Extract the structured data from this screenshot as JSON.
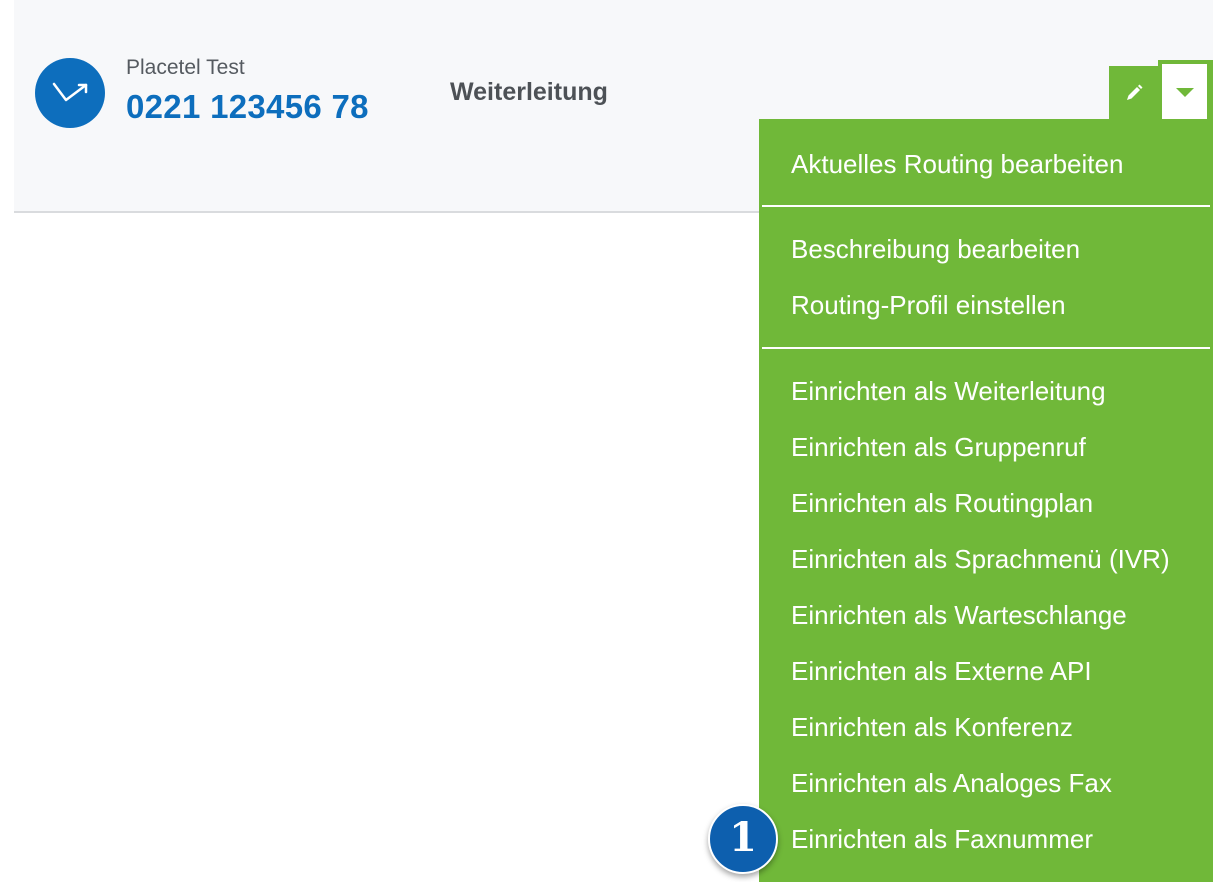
{
  "number": {
    "caption": "Placetel Test",
    "phone": "0221 123456 78",
    "routing_type": "Weiterleitung",
    "icon": "forward-arrow-icon"
  },
  "actions": {
    "edit_icon": "pencil-icon",
    "dropdown_icon": "caret-down-icon"
  },
  "menu": {
    "groups": [
      [
        "Aktuelles Routing bearbeiten"
      ],
      [
        "Beschreibung bearbeiten",
        "Routing-Profil einstellen"
      ],
      [
        "Einrichten als Weiterleitung",
        "Einrichten als Gruppenruf",
        "Einrichten als Routingplan",
        "Einrichten als Sprachmenü (IVR)",
        "Einrichten als Warteschlange",
        "Einrichten als Externe API",
        "Einrichten als Konferenz",
        "Einrichten als Analoges Fax",
        "Einrichten als Faxnummer"
      ]
    ]
  },
  "annotation": {
    "badge": "1"
  },
  "colors": {
    "brand_blue": "#0d6ebd",
    "menu_green": "#70b839",
    "card_bg": "#f7f8fa"
  }
}
